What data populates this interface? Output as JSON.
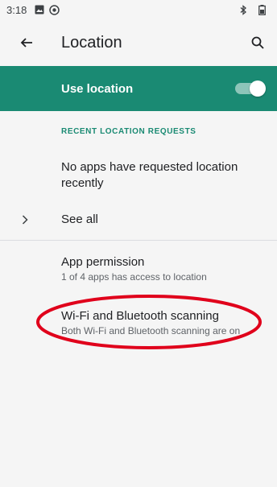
{
  "status_bar": {
    "time": "3:18",
    "icons_left": [
      "image-icon",
      "sync-icon"
    ],
    "icons_right": [
      "bluetooth-icon",
      "battery-icon"
    ]
  },
  "app_bar": {
    "title": "Location",
    "back_icon": "arrow-back-icon",
    "search_icon": "search-icon"
  },
  "use_location": {
    "label": "Use location",
    "enabled": true,
    "color": "#1a8a73"
  },
  "recent_requests": {
    "header": "RECENT LOCATION REQUESTS",
    "empty_message": "No apps have requested location recently",
    "see_all_label": "See all"
  },
  "settings": [
    {
      "title": "App permission",
      "subtitle": "1 of 4 apps has access to location"
    },
    {
      "title": "Wi-Fi and Bluetooth scanning",
      "subtitle": "Both Wi-Fi and Bluetooth scanning are on"
    }
  ],
  "annotation": {
    "shape": "ellipse",
    "color": "#e0001b"
  }
}
